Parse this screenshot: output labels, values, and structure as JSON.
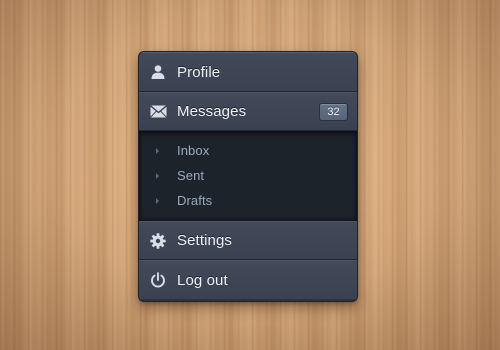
{
  "menu": {
    "items": [
      {
        "id": "profile",
        "label": "Profile",
        "icon": "user-icon"
      },
      {
        "id": "messages",
        "label": "Messages",
        "icon": "envelope-icon",
        "badge": "32"
      },
      {
        "id": "settings",
        "label": "Settings",
        "icon": "gear-icon"
      },
      {
        "id": "logout",
        "label": "Log out",
        "icon": "power-icon"
      }
    ],
    "submenu": {
      "parent": "messages",
      "items": [
        {
          "label": "Inbox"
        },
        {
          "label": "Sent"
        },
        {
          "label": "Drafts"
        }
      ]
    }
  },
  "colors": {
    "background": "#d9a676",
    "menu_item": "#3e4554",
    "submenu": "#1d232b",
    "label": "#eef1f6",
    "sublabel": "#9aabbd",
    "badge": "#5f6c83"
  }
}
